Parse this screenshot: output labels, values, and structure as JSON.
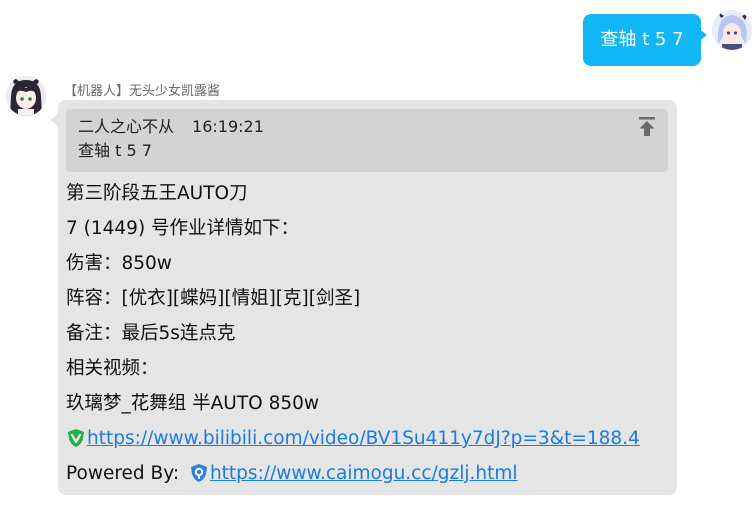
{
  "sent_message": {
    "text": "查轴 t 5 7"
  },
  "bot": {
    "sender_label": "【机器人】无头少女凯露酱"
  },
  "reply": {
    "quote": {
      "author": "二人之心不从",
      "time": "16:19:21",
      "text": "查轴 t 5 7"
    },
    "lines": [
      "第三阶段五王AUTO刀",
      "7 (1449) 号作业详情如下：",
      "伤害：850w",
      "阵容：[优衣][蝶妈][情姐][克][剑圣]",
      "备注：最后5s连点克",
      "相关视频：",
      "玖璃梦_花舞组 半AUTO 850w"
    ],
    "video_link": "https://www.bilibili.com/video/BV1Su411y7dJ?p=3&t=188.4",
    "powered_by_label": "Powered By:",
    "powered_by_link": "https://www.caimogu.cc/gzlj.html"
  },
  "colors": {
    "sent_bubble": "#12b7f5",
    "reply_bubble": "#e5e5e5",
    "quote_block": "#d3d3d3",
    "link": "#1a7be0",
    "video_icon": "#22b24c",
    "powered_icon": "#2f7fe6"
  },
  "icons": {
    "quote_jump": "arrow-up-to-top-icon",
    "video": "green-v-shield-icon",
    "powered": "blue-shield-icon"
  }
}
